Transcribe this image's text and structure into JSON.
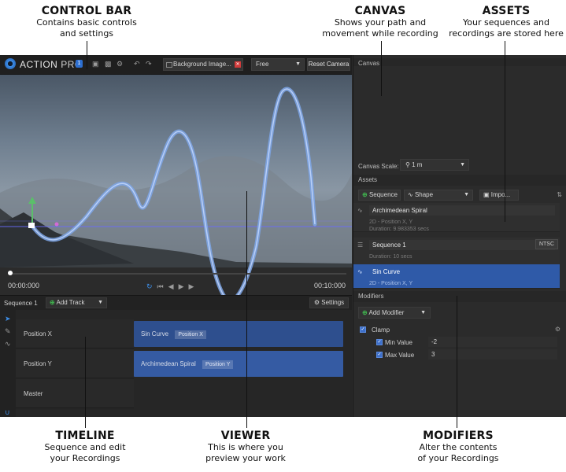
{
  "callouts": {
    "control_bar": {
      "title": "CONTROL BAR",
      "desc1": "Contains basic controls",
      "desc2": "and settings"
    },
    "canvas": {
      "title": "CANVAS",
      "desc1": "Shows your path and",
      "desc2": "movement while recording"
    },
    "assets": {
      "title": "ASSETS",
      "desc1": "Your sequences and",
      "desc2": "recordings are stored here"
    },
    "timeline": {
      "title": "TIMELINE",
      "desc1": "Sequence and edit",
      "desc2": "your Recordings"
    },
    "viewer": {
      "title": "VIEWER",
      "desc1": "This is where you",
      "desc2": "preview your work"
    },
    "modifiers": {
      "title": "MODIFIERS",
      "desc1": "Alter the contents",
      "desc2": "of your Recordings"
    }
  },
  "control_bar": {
    "logo_action": "ACTION",
    "logo_pro": "PRO",
    "version": "1",
    "background_image": "Background Image...",
    "mode": "Free",
    "reset_camera": "Reset Camera"
  },
  "viewer": {
    "timecode_start": "00:00:000",
    "timecode_end": "00:10:000",
    "playhead_fraction": 0.0
  },
  "timeline": {
    "sequence_label": "Sequence 1",
    "add_track": "Add Track",
    "settings": "Settings",
    "tracks": [
      {
        "name": "Position X",
        "clip": "Sin Curve",
        "tag": "Position X"
      },
      {
        "name": "Position Y",
        "clip": "Archimedean Spiral",
        "tag": "Position Y"
      },
      {
        "name": "Master",
        "clip": "",
        "tag": ""
      }
    ]
  },
  "right_panel": {
    "canvas_title": "Canvas",
    "canvas_scale_label": "Canvas Scale:",
    "canvas_scale_value": "1 m",
    "assets_title": "Assets",
    "btn_sequence": "Sequence",
    "btn_shape": "Shape",
    "btn_import": "Impo...",
    "assets": [
      {
        "name": "Archimedean Spiral",
        "sub1": "2D - Position X, Y",
        "sub2": "Duration: 9.983353 secs",
        "selected": false
      },
      {
        "name": "Sequence 1",
        "sub1": "Duration: 10 secs",
        "sub2": "",
        "badge": "NTSC",
        "selected": false
      },
      {
        "name": "Sin Curve",
        "sub1": "2D - Position X, Y",
        "sub2": "",
        "selected": true
      }
    ],
    "modifiers_title": "Modifiers",
    "add_modifier": "Add Modifier",
    "clamp": "Clamp",
    "min_label": "Min Value",
    "min_value": "-2",
    "max_label": "Max Value",
    "max_value": "3"
  },
  "colors": {
    "accent": "#3d8ee8",
    "selected_asset": "#2f5aa8",
    "clip_blue": "#2e4f8e",
    "add_green": "#3fae4d",
    "close_red": "#d23b3b"
  }
}
